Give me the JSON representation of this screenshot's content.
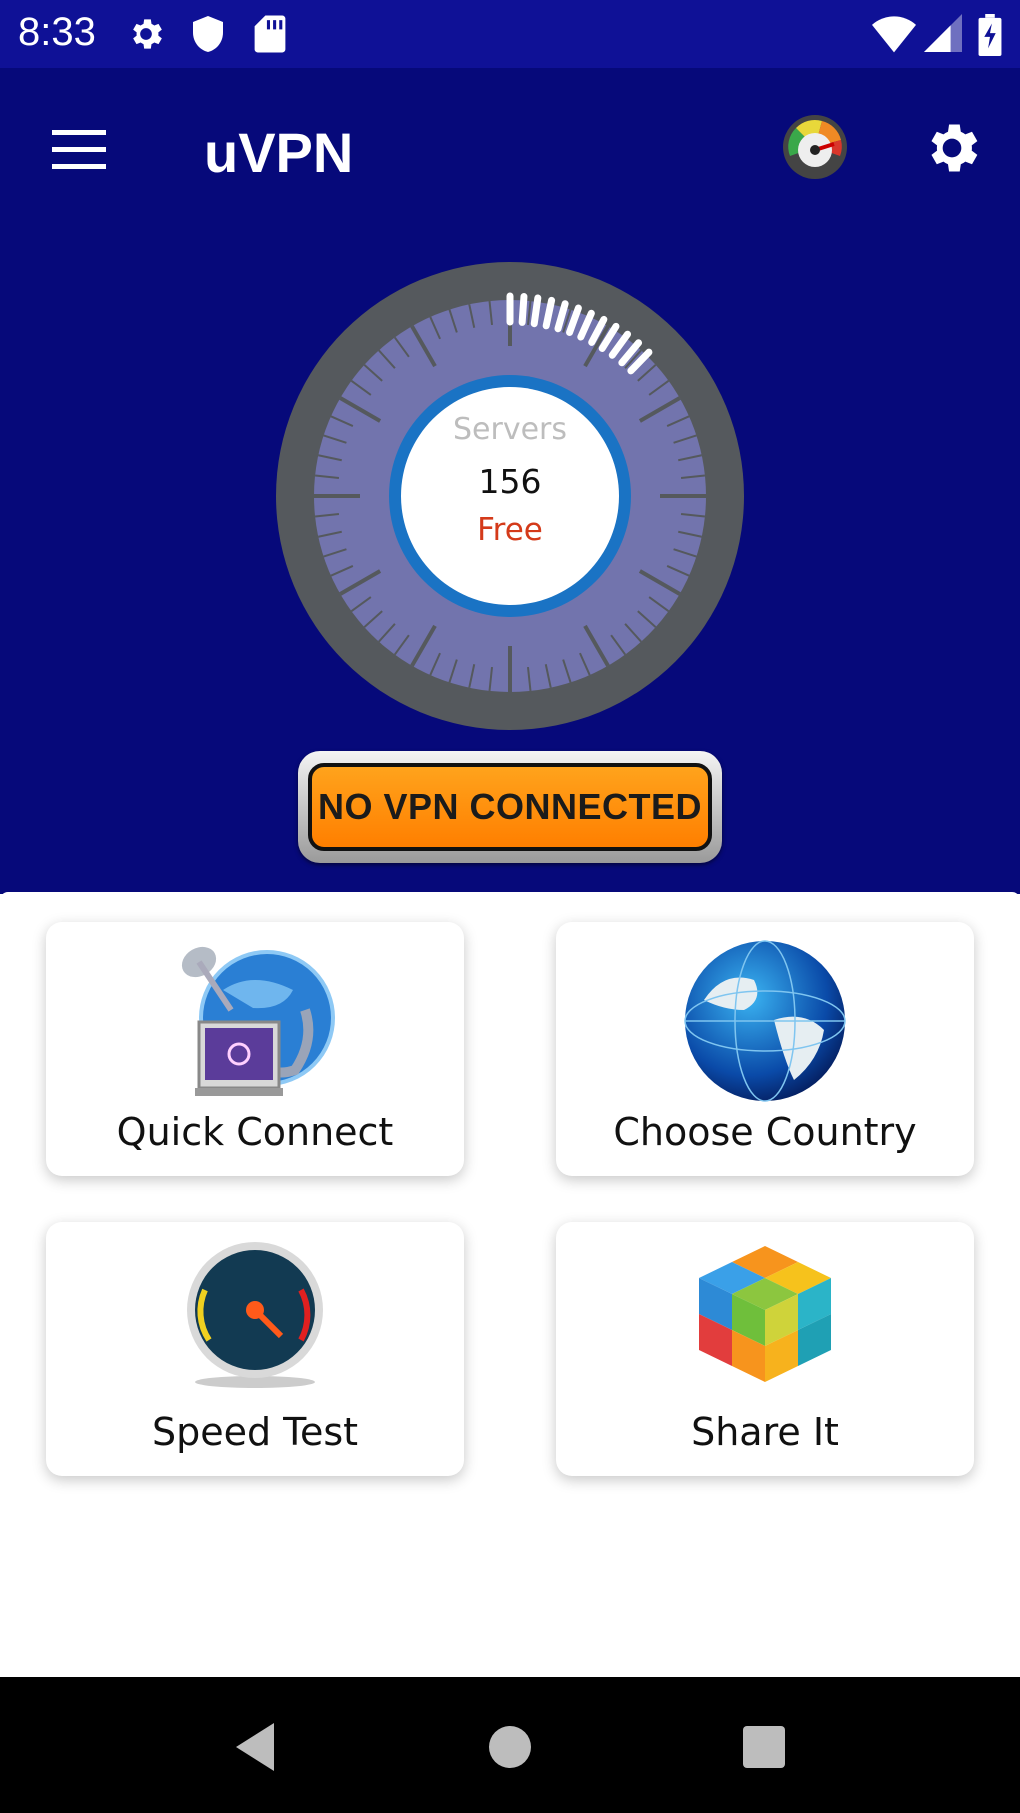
{
  "status_bar": {
    "time": "8:33",
    "icons": [
      "settings-icon",
      "shield-icon",
      "sd-card-icon",
      "wifi-icon",
      "signal-icon",
      "battery-charging-icon"
    ]
  },
  "app_bar": {
    "title": "uVPN",
    "menu_icon": "hamburger-menu-icon",
    "speedometer_icon": "speedometer-icon",
    "settings_icon": "gear-icon"
  },
  "dial": {
    "label": "Servers",
    "count": "156",
    "tier": "Free"
  },
  "connection_status": {
    "label": "NO VPN CONNECTED",
    "color": "#ff8c00"
  },
  "cards": [
    {
      "label": "Quick Connect",
      "icon": "quick-connect-icon"
    },
    {
      "label": "Choose Country",
      "icon": "globe-icon"
    },
    {
      "label": "Speed Test",
      "icon": "speed-gauge-icon"
    },
    {
      "label": "Share It",
      "icon": "share-cube-icon"
    }
  ],
  "nav_bar": {
    "buttons": [
      "back-icon",
      "home-icon",
      "recents-icon"
    ]
  },
  "colors": {
    "status_bar": "#0f1196",
    "app_background": "#06097a",
    "dial_ring": "#55595d",
    "dial_face": "#7274ad",
    "inner_ring": "#1a73c4",
    "free_text": "#d43a1a"
  }
}
